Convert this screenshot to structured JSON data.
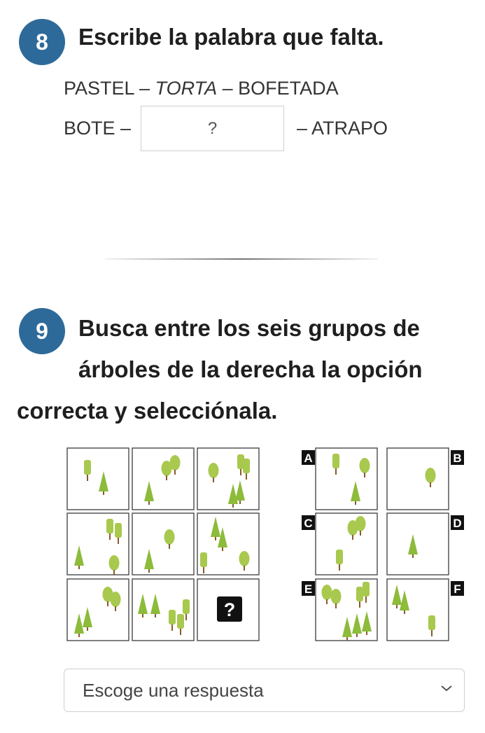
{
  "q8": {
    "number": "8",
    "title": "Escribe la palabra que falta.",
    "ex_a": "PASTEL –",
    "ex_b": "TORTA",
    "ex_c": "– BOFETADA",
    "q_a": "BOTE –",
    "q_box": "?",
    "q_c": "– ATRAPO"
  },
  "q9": {
    "number": "9",
    "title_1": "Busca entre los seis grupos de",
    "title_2": "árboles de la derecha la opción",
    "title_3": "correcta y selecciónala.",
    "missing_mark": "?",
    "options": [
      "A",
      "B",
      "C",
      "D",
      "E",
      "F"
    ]
  },
  "answer_select": {
    "placeholder": "Escoge una respuesta"
  },
  "colors": {
    "badge": "#2e6a99",
    "tree_green": "#8dbb3a",
    "tree_light": "#a8c94e",
    "trunk": "#8a5a2a"
  },
  "icons": [
    "pine-tree-icon",
    "round-tree-icon",
    "cylinder-tree-icon",
    "chevron-down-icon"
  ]
}
